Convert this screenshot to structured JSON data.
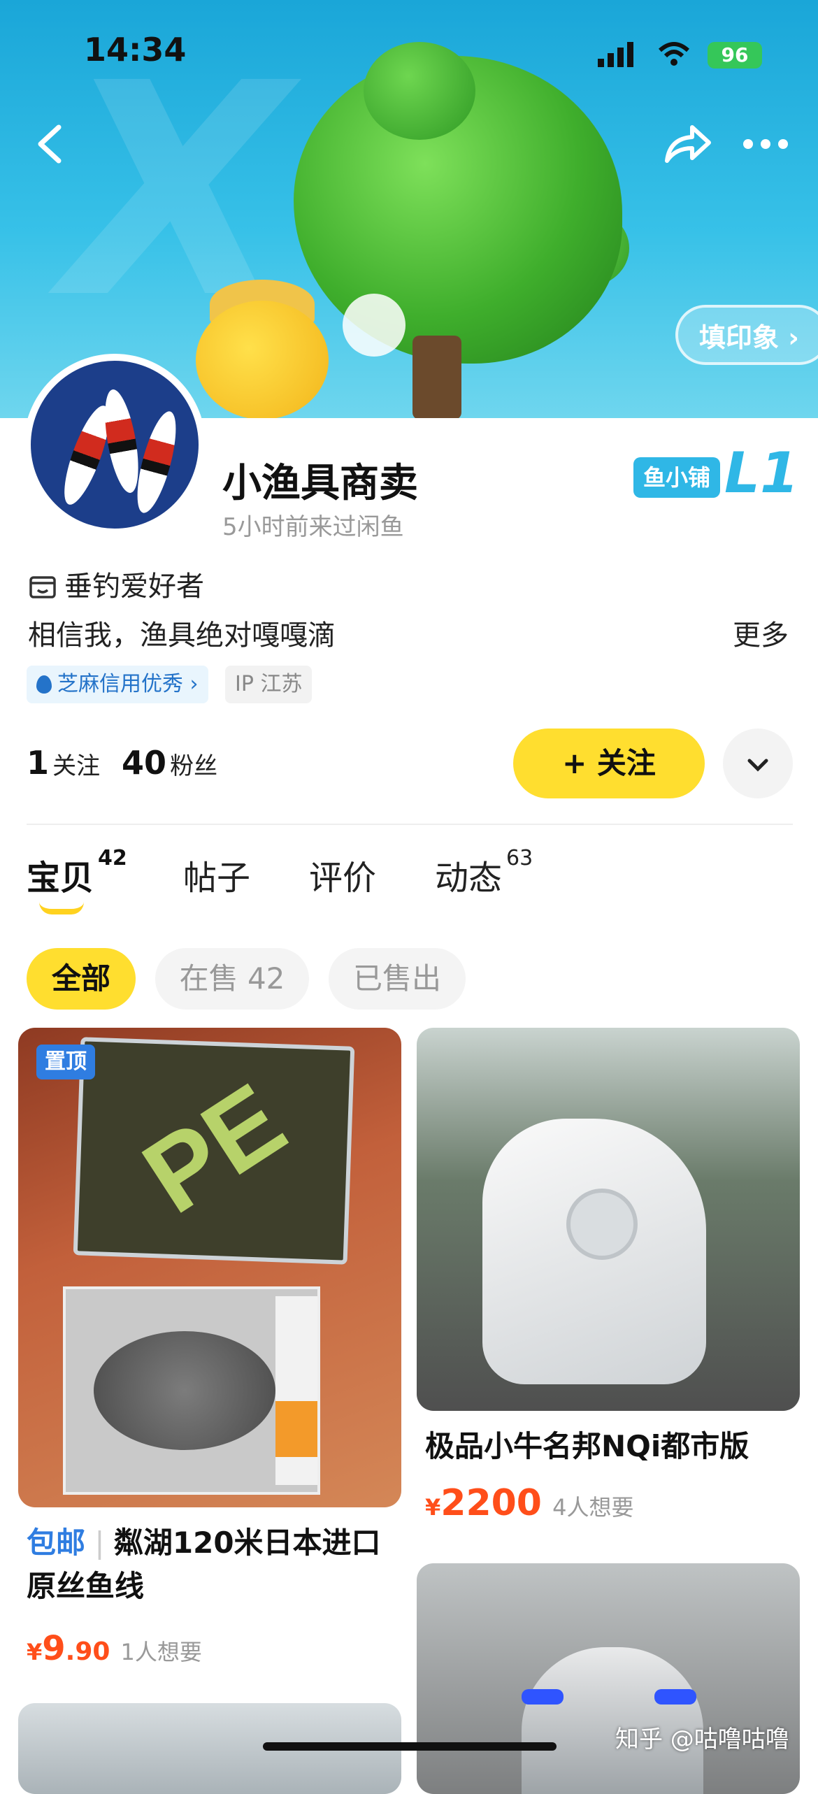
{
  "status_bar": {
    "time": "14:34",
    "battery": "96"
  },
  "header": {
    "impression_button": "填印象 ›"
  },
  "profile": {
    "name": "小渔具商卖",
    "last_seen": "5小时前来过闲鱼",
    "level_badge": "鱼小铺",
    "level": "L1",
    "hobby": "垂钓爱好者",
    "bio": "相信我，渔具绝对嘎嘎滴",
    "more_label": "更多",
    "credit_badge": "芝麻信用优秀 ›",
    "ip_location": "IP 江苏",
    "following_count": "1",
    "following_label": "关注",
    "followers_count": "40",
    "followers_label": "粉丝",
    "follow_button": "+ 关注"
  },
  "tabs": [
    {
      "label": "宝贝",
      "count": "42"
    },
    {
      "label": "帖子",
      "count": ""
    },
    {
      "label": "评价",
      "count": ""
    },
    {
      "label": "动态",
      "count": "63"
    }
  ],
  "filters": [
    "全部",
    "在售 42",
    "已售出"
  ],
  "products": [
    {
      "pinned_label": "置顶",
      "shipping_tag": "包邮",
      "title": "粼湖120米日本进口原丝鱼线",
      "price_symbol": "¥",
      "price_int": "9",
      "price_dec": ".90",
      "wants": "1人想要"
    },
    {
      "title": "极品小牛名邦NQi都市版",
      "price_symbol": "¥",
      "price_int": "2200",
      "wants": "4人想要"
    }
  ],
  "watermark": "知乎 @咕噜咕噜",
  "colors": {
    "accent_yellow": "#ffde2f",
    "banner_blue": "#1aa6d8",
    "price_red": "#ff4e1a",
    "link_blue": "#2f7de1"
  }
}
